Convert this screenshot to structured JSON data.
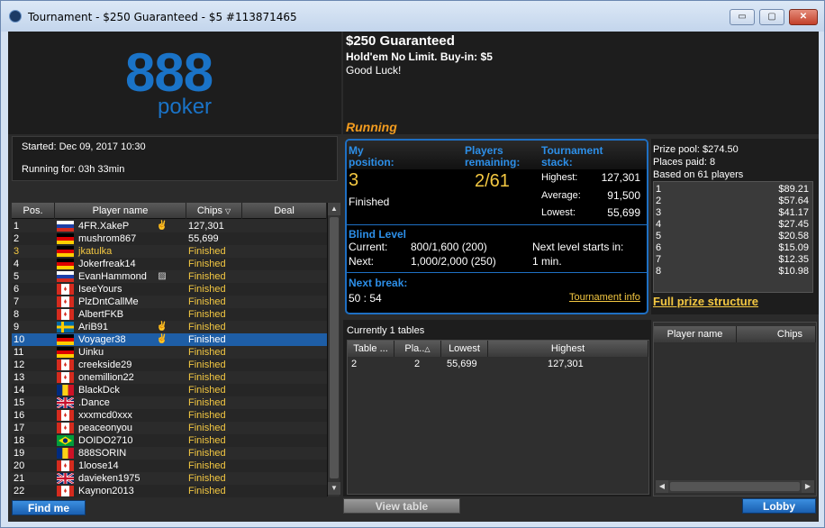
{
  "window": {
    "title": "Tournament - $250 Guaranteed - $5 #113871465",
    "minimize": "▭",
    "restore": "▢",
    "close": "✕"
  },
  "brand": {
    "logo_number": "888",
    "logo_word": "poker"
  },
  "tournament": {
    "name": "$250 Guaranteed",
    "game": "Hold'em No Limit. Buy-in: $5",
    "greeting": "Good Luck!",
    "status": "Running",
    "started": "Started: Dec 09, 2017 10:30",
    "running_for": "Running for: 03h 33min"
  },
  "players_table": {
    "headers": {
      "pos": "Pos.",
      "name": "Player name",
      "chips": "Chips",
      "deal": "Deal"
    },
    "rows": [
      {
        "pos": "1",
        "flag": "ru",
        "name": "4FR.XakeP",
        "badge": "hands",
        "chips": "127,301"
      },
      {
        "pos": "2",
        "flag": "de",
        "name": "mushrom867",
        "badge": "",
        "chips": "55,699"
      },
      {
        "pos": "3",
        "flag": "de",
        "name": "jkatulka",
        "badge": "",
        "chips": "Finished",
        "highlight": true
      },
      {
        "pos": "4",
        "flag": "de",
        "name": "Jokerfreak14",
        "badge": "",
        "chips": "Finished"
      },
      {
        "pos": "5",
        "flag": "ru",
        "name": "EvanHammond",
        "badge": "card",
        "chips": "Finished"
      },
      {
        "pos": "6",
        "flag": "ca",
        "name": "IseeYours",
        "badge": "",
        "chips": "Finished"
      },
      {
        "pos": "7",
        "flag": "ca",
        "name": "PlzDntCallMe",
        "badge": "",
        "chips": "Finished"
      },
      {
        "pos": "8",
        "flag": "ca",
        "name": "AlbertFKB",
        "badge": "",
        "chips": "Finished"
      },
      {
        "pos": "9",
        "flag": "se",
        "name": "AriB91",
        "badge": "hands",
        "chips": "Finished"
      },
      {
        "pos": "10",
        "flag": "de",
        "name": "Voyager38",
        "badge": "hands",
        "chips": "Finished",
        "selected": true
      },
      {
        "pos": "11",
        "flag": "de",
        "name": "Uinku",
        "badge": "",
        "chips": "Finished"
      },
      {
        "pos": "12",
        "flag": "ca",
        "name": "creekside29",
        "badge": "",
        "chips": "Finished"
      },
      {
        "pos": "13",
        "flag": "ca",
        "name": "onemillion22",
        "badge": "",
        "chips": "Finished"
      },
      {
        "pos": "14",
        "flag": "ro",
        "name": "BlackDck",
        "badge": "",
        "chips": "Finished"
      },
      {
        "pos": "15",
        "flag": "gb",
        "name": ".Dance",
        "badge": "",
        "chips": "Finished"
      },
      {
        "pos": "16",
        "flag": "ca",
        "name": "xxxmcd0xxx",
        "badge": "",
        "chips": "Finished"
      },
      {
        "pos": "17",
        "flag": "ca",
        "name": "peaceonyou",
        "badge": "",
        "chips": "Finished"
      },
      {
        "pos": "18",
        "flag": "br",
        "name": "DOIDO2710",
        "badge": "",
        "chips": "Finished"
      },
      {
        "pos": "19",
        "flag": "ro",
        "name": "888SORIN",
        "badge": "",
        "chips": "Finished"
      },
      {
        "pos": "20",
        "flag": "ca",
        "name": "1loose14",
        "badge": "",
        "chips": "Finished"
      },
      {
        "pos": "21",
        "flag": "gb",
        "name": "davieken1975",
        "badge": "",
        "chips": "Finished"
      },
      {
        "pos": "22",
        "flag": "ca",
        "name": "Kaynon2013",
        "badge": "",
        "chips": "Finished"
      }
    ]
  },
  "buttons": {
    "find_me": "Find me",
    "view_table": "View table",
    "lobby": "Lobby"
  },
  "position": {
    "label": "My position:",
    "value": "3",
    "state": "Finished",
    "players_label": "Players remaining:",
    "players_value": "2/61",
    "stack_label": "Tournament stack:",
    "highest_label": "Highest:",
    "highest": "127,301",
    "average_label": "Average:",
    "average": "91,500",
    "lowest_label": "Lowest:",
    "lowest": "55,699"
  },
  "blinds": {
    "label": "Blind Level",
    "current_label": "Current:",
    "current": "800/1,600 (200)",
    "next_label": "Next:",
    "next": "1,000/2,000 (250)",
    "next_level_label": "Next level starts in:",
    "next_level": "1 min.",
    "break_label": "Next break:",
    "break_value": "50 : 54",
    "info_link": "Tournament info"
  },
  "prize": {
    "pool": "Prize pool: $274.50",
    "paid": "Places paid: 8",
    "based": "Based on 61 players",
    "rows": [
      {
        "place": "1",
        "amount": "$89.21"
      },
      {
        "place": "2",
        "amount": "$57.64"
      },
      {
        "place": "3",
        "amount": "$41.17"
      },
      {
        "place": "4",
        "amount": "$27.45"
      },
      {
        "place": "5",
        "amount": "$20.58"
      },
      {
        "place": "6",
        "amount": "$15.09"
      },
      {
        "place": "7",
        "amount": "$12.35"
      },
      {
        "place": "8",
        "amount": "$10.98"
      }
    ],
    "full_link": "Full prize structure"
  },
  "tables": {
    "caption": "Currently 1 tables",
    "headers": {
      "table": "Table ...",
      "players": "Pla..",
      "lowest": "Lowest",
      "highest": "Highest"
    },
    "rows": [
      {
        "table": "2",
        "players": "2",
        "lowest": "55,699",
        "highest": "127,301"
      }
    ]
  },
  "table_players": {
    "headers": {
      "name": "Player name",
      "chips": "Chips"
    }
  },
  "colors": {
    "accent_blue": "#2d8fe8",
    "status_orange": "#f39c1f",
    "highlight_yellow": "#f4c842"
  }
}
